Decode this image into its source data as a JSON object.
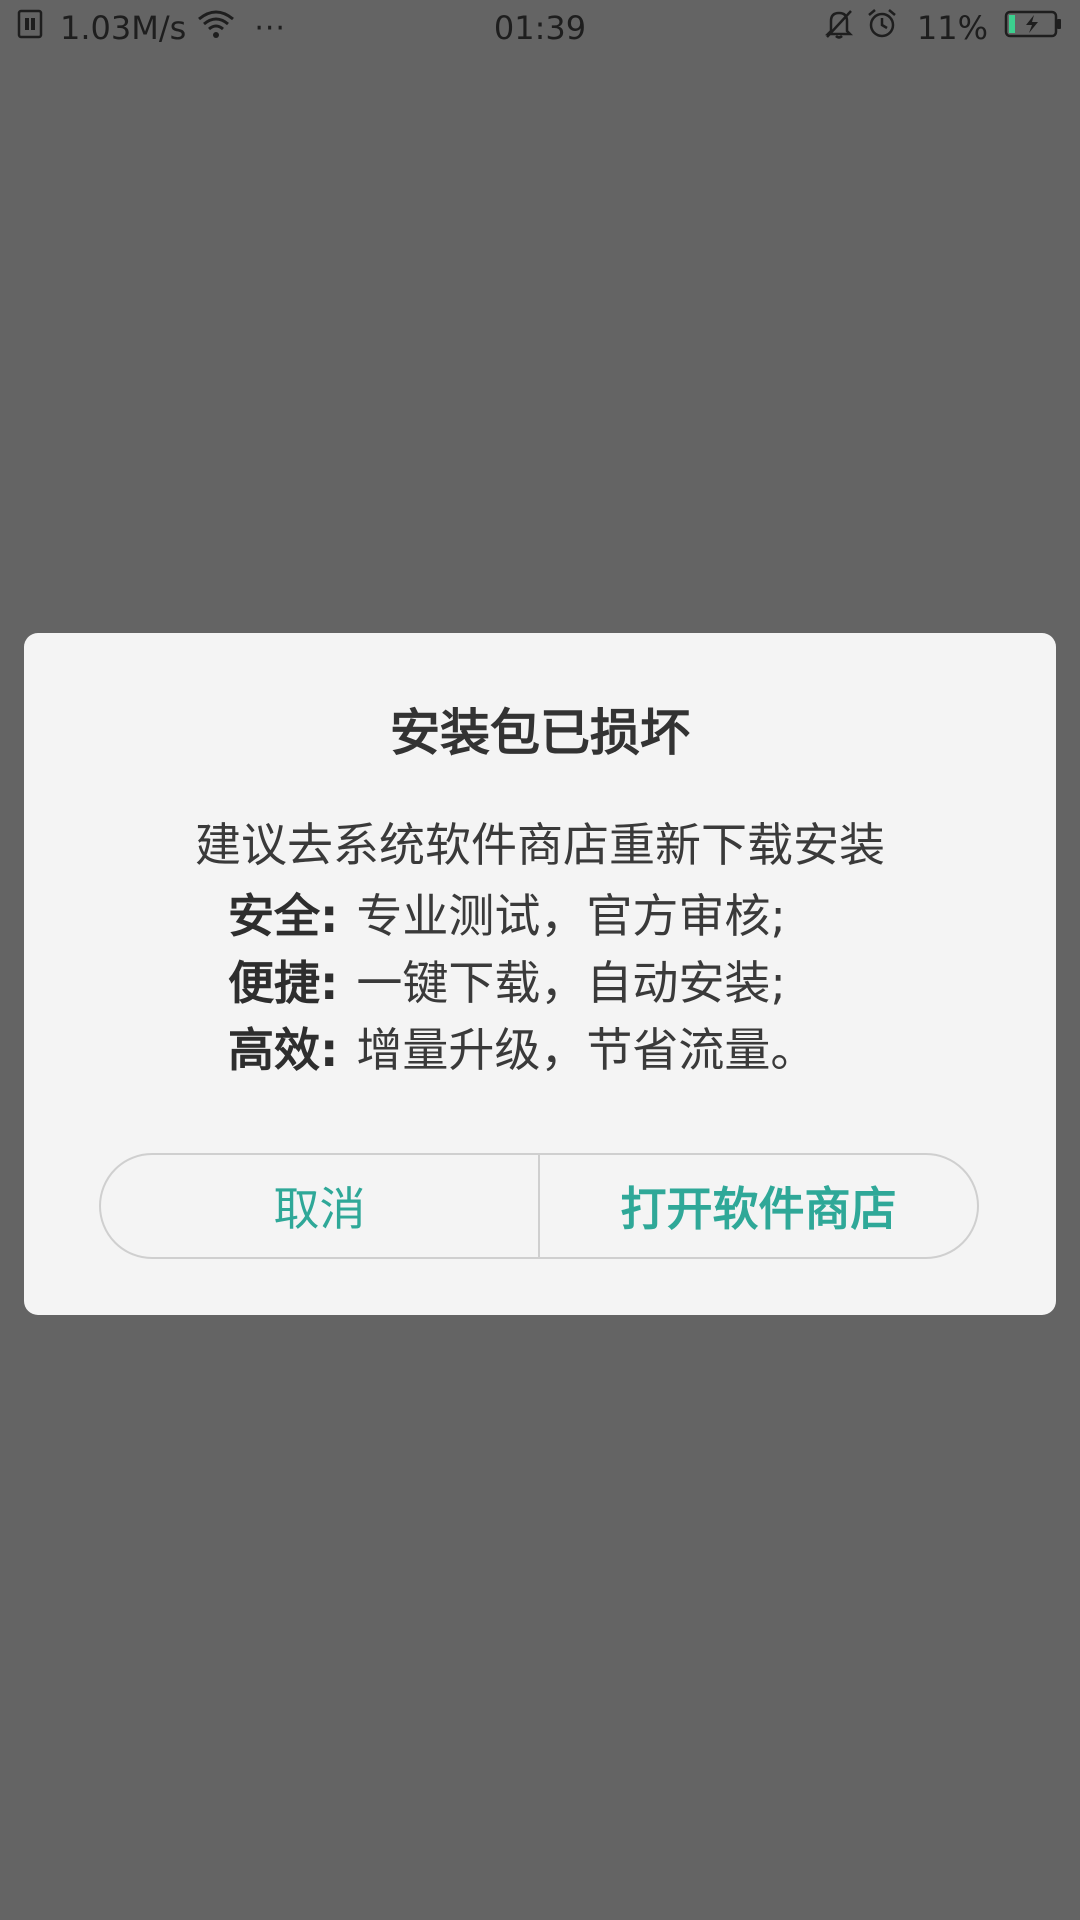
{
  "status_bar": {
    "network_speed": "1.03M/s",
    "more_indicator": "···",
    "time": "01:39",
    "battery_percent": "11%",
    "battery_level": 0.11,
    "icons": [
      "sim-icon",
      "wifi-icon",
      "bell-muted-icon",
      "alarm-icon",
      "battery-charging-icon"
    ]
  },
  "dialog": {
    "title": "安装包已损坏",
    "subtitle": "建议去系统软件商店重新下载安装",
    "features": [
      {
        "label": "安全:",
        "desc": "专业测试，官方审核;"
      },
      {
        "label": "便捷:",
        "desc": "一键下载，自动安装;"
      },
      {
        "label": "高效:",
        "desc": "增量升级，节省流量。"
      }
    ],
    "cancel_label": "取消",
    "confirm_label": "打开软件商店"
  },
  "colors": {
    "overlay": "#646464",
    "dialog_bg": "#f4f4f4",
    "accent": "#2fa898",
    "battery_green": "#3ccf8e"
  }
}
